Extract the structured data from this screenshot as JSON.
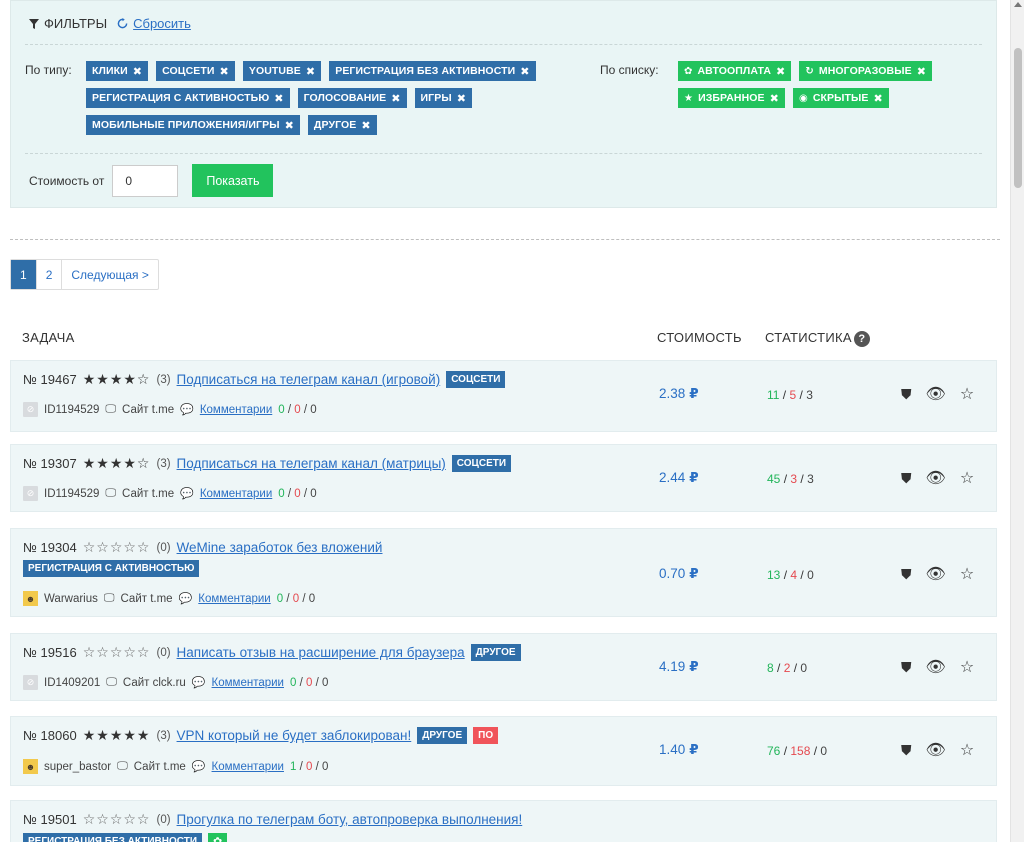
{
  "filters": {
    "title": "ФИЛЬТРЫ",
    "reset_label": "Сбросить",
    "by_type_label": "По типу:",
    "by_list_label": "По списку:",
    "type_tags": [
      "КЛИКИ",
      "СОЦСЕТИ",
      "YOUTUBE",
      "РЕГИСТРАЦИЯ БЕЗ АКТИВНОСТИ",
      "РЕГИСТРАЦИЯ С АКТИВНОСТЬЮ",
      "ГОЛОСОВАНИЕ",
      "ИГРЫ",
      "МОБИЛЬНЫЕ ПРИЛОЖЕНИЯ/ИГРЫ",
      "ДРУГОЕ"
    ],
    "list_tags": [
      "АВТООПЛАТА",
      "МНОГОРАЗОВЫЕ",
      "ИЗБРАННОЕ",
      "СКРЫТЫЕ"
    ],
    "cost_from_label": "Стоимость от",
    "cost_from_value": "0",
    "show_button": "Показать"
  },
  "pagination": {
    "pages": [
      "1",
      "2"
    ],
    "next": "Следующая >"
  },
  "table_header": {
    "task": "ЗАДАЧА",
    "cost": "СТОИМОСТЬ",
    "stats": "СТАТИСТИКА",
    "help": "?"
  },
  "currency": "₽",
  "tasks": [
    {
      "num": "№ 19467",
      "stars": "★★★★☆",
      "rating": "(3)",
      "title": "Подписаться на телеграм канал (игровой)",
      "badges": [
        "СОЦСЕТИ"
      ],
      "user": "ID1194529",
      "site": "Сайт t.me",
      "comments_label": "Комментарии",
      "c1": "0",
      "c2": "0",
      "c3": "0",
      "price": "2.38",
      "s1": "11",
      "s2": "5",
      "s3": "3"
    },
    {
      "num": "№ 19307",
      "stars": "★★★★☆",
      "rating": "(3)",
      "title": "Подписаться на телеграм канал (матрицы)",
      "badges": [
        "СОЦСЕТИ"
      ],
      "user": "ID1194529",
      "site": "Сайт t.me",
      "comments_label": "Комментарии",
      "c1": "0",
      "c2": "0",
      "c3": "0",
      "price": "2.44",
      "s1": "45",
      "s2": "3",
      "s3": "3"
    },
    {
      "num": "№ 19304",
      "stars": "☆☆☆☆☆",
      "rating": "(0)",
      "title": "WeMine заработок без вложений",
      "badges": [
        "РЕГИСТРАЦИЯ С АКТИВНОСТЬЮ"
      ],
      "user": "Warwarius",
      "site": "Сайт t.me",
      "comments_label": "Комментарии",
      "c1": "0",
      "c2": "0",
      "c3": "0",
      "price": "0.70",
      "s1": "13",
      "s2": "4",
      "s3": "0"
    },
    {
      "num": "№ 19516",
      "stars": "☆☆☆☆☆",
      "rating": "(0)",
      "title": "Написать отзыв на расширение для браузера",
      "badges": [
        "ДРУГОЕ"
      ],
      "user": "ID1409201",
      "site": "Сайт clck.ru",
      "comments_label": "Комментарии",
      "c1": "0",
      "c2": "0",
      "c3": "0",
      "price": "4.19",
      "s1": "8",
      "s2": "2",
      "s3": "0"
    },
    {
      "num": "№ 18060",
      "stars": "★★★★★",
      "rating": "(3)",
      "title": "VPN который не будет заблокирован!",
      "badges": [
        "ДРУГОЕ",
        "ПО"
      ],
      "user": "super_bastor",
      "site": "Сайт t.me",
      "comments_label": "Комментарии",
      "c1": "1",
      "c2": "0",
      "c3": "0",
      "price": "1.40",
      "s1": "76",
      "s2": "158",
      "s3": "0"
    },
    {
      "num": "№ 19501",
      "stars": "☆☆☆☆☆",
      "rating": "(0)",
      "title": "Прогулка по телеграм боту, автопроверка выполнения!",
      "badges": [
        "РЕГИСТРАЦИЯ БЕЗ АКТИВНОСТИ"
      ]
    }
  ]
}
